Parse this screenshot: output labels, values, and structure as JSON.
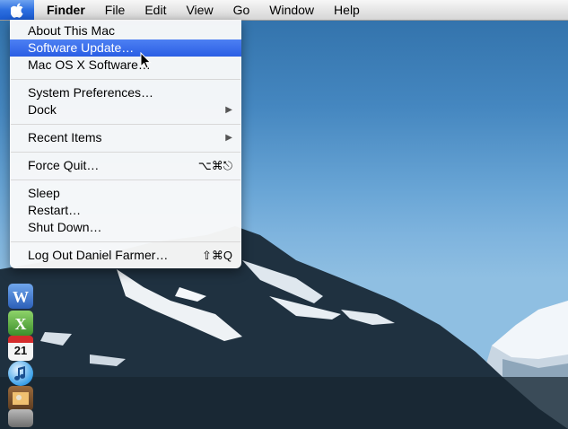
{
  "menubar": {
    "apple_icon": "apple-icon",
    "items": [
      "Finder",
      "File",
      "Edit",
      "View",
      "Go",
      "Window",
      "Help"
    ]
  },
  "apple_menu": {
    "about": "About This Mac",
    "software_update": "Software Update…",
    "mac_os_x_software": "Mac OS X Software…",
    "system_preferences": "System Preferences…",
    "dock": "Dock",
    "recent_items": "Recent Items",
    "force_quit": "Force Quit…",
    "force_quit_shortcut": "⌥⌘⎋",
    "sleep": "Sleep",
    "restart": "Restart…",
    "shut_down": "Shut Down…",
    "log_out": "Log Out Daniel Farmer…",
    "log_out_shortcut": "⇧⌘Q",
    "selected_item": "Software Update…"
  },
  "dock": {
    "icons": [
      "word-icon",
      "excel-icon",
      "ical-icon",
      "itunes-icon",
      "iphoto-icon",
      "app-icon"
    ],
    "ical_date": "21"
  },
  "colors": {
    "selection": "#2a5ee4",
    "apple_highlight": "#2d6fe0",
    "sky": "#7fb4de",
    "mountain": "#1f3140"
  }
}
